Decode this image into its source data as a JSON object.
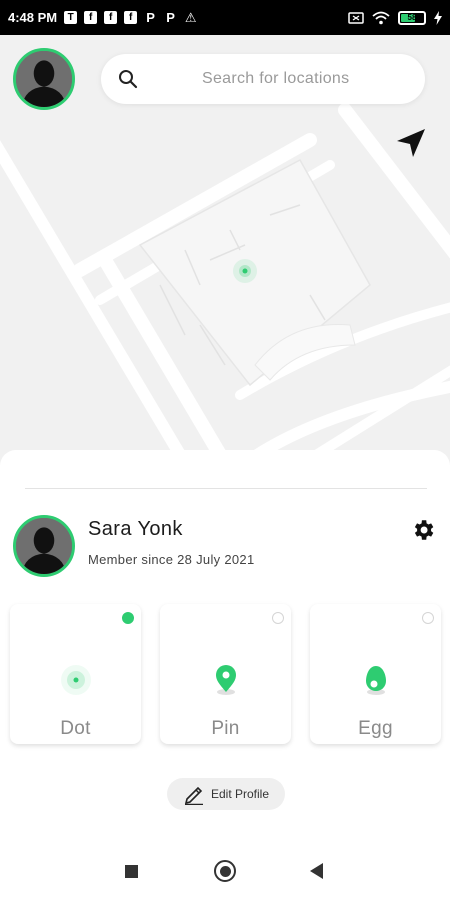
{
  "status_bar": {
    "time": "4:48 PM",
    "notification_icons": [
      "T",
      "f",
      "f",
      "f",
      "P",
      "P",
      "⚠"
    ],
    "battery_label": "58"
  },
  "search": {
    "placeholder": "Search for locations"
  },
  "profile": {
    "name": "Sara Yonk",
    "member_since": "Member since 28 July 2021"
  },
  "marker_styles": [
    {
      "label": "Dot",
      "selected": true,
      "icon": "dot-marker-icon"
    },
    {
      "label": "Pin",
      "selected": false,
      "icon": "pin-marker-icon"
    },
    {
      "label": "Egg",
      "selected": false,
      "icon": "egg-marker-icon"
    }
  ],
  "edit_button": {
    "label": "Edit Profile"
  },
  "colors": {
    "accent": "#2ecc71",
    "map_background": "#f1f1f1",
    "road": "#ffffff"
  }
}
